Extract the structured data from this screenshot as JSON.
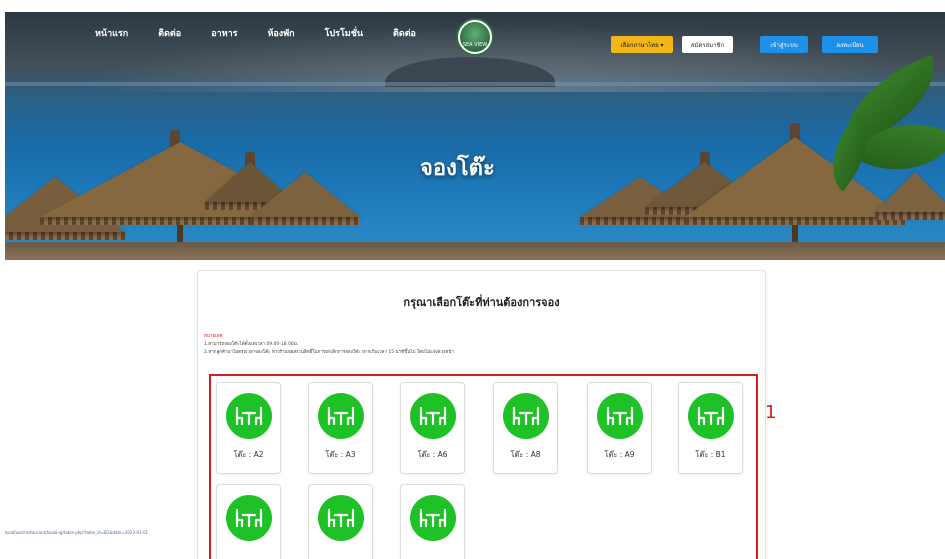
{
  "nav": {
    "items": [
      "หน้าแรก",
      "ติดต่อ",
      "อาหาร",
      "ห้องพัก",
      "โปรโมชั่น",
      "ติดต่อ"
    ]
  },
  "logo": {
    "text": "SEA VIEW"
  },
  "header_buttons": {
    "language": "เลือกภาษาไทย ▾",
    "account": "สมัครสมาชิก",
    "login": "เข้าสู่ระบบ",
    "register": "ลงทะเบียน"
  },
  "hero": {
    "title": "จองโต๊ะ"
  },
  "booking": {
    "heading": "กรุณาเลือกโต๊ะที่ท่านต้องการจอง",
    "remark_title": "หมายเหตุ",
    "remarks": [
      "1.สามารถจองโต๊ะได้ตั้งแต่เวลา 09.00-18.00น.",
      "2.หากลูกค้ามาไม่ตรงเวลาจองโต๊ะ ทางร้านขอสงวนสิทธิ์ในการยกเลิกการจองโต๊ะ หากเกินเวลา 15 นาทีขึ้นไป โดยไม่แจ้งล่วงหน้า"
    ],
    "tables": [
      {
        "label": "โต๊ะ : A2"
      },
      {
        "label": "โต๊ะ : A3"
      },
      {
        "label": "โต๊ะ : A6"
      },
      {
        "label": "โต๊ะ : A8"
      },
      {
        "label": "โต๊ะ : A9"
      },
      {
        "label": "โต๊ะ : B1"
      },
      {
        "label": ""
      },
      {
        "label": ""
      },
      {
        "label": ""
      }
    ]
  },
  "annotation": {
    "number": "1"
  },
  "status_bar": {
    "url": "localhost/restaurant/booking/table.php?table_id=B1&date=2023-01-01"
  },
  "colors": {
    "table_available": "#1ec227",
    "annotation": "#d71c1c",
    "primary_button": "#1e90e8",
    "language_button": "#f2b616"
  }
}
